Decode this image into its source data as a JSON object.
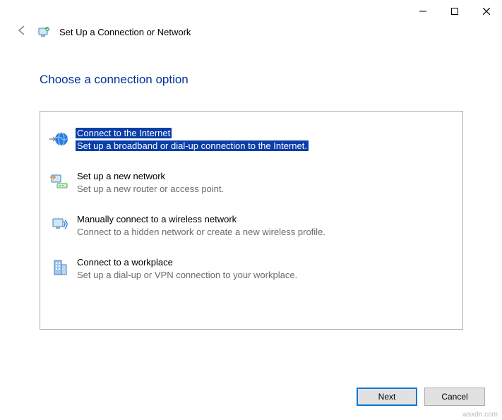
{
  "window": {
    "title": "Set Up a Connection or Network"
  },
  "instruction": "Choose a connection option",
  "options": [
    {
      "title": "Connect to the Internet",
      "desc": "Set up a broadband or dial-up connection to the Internet.",
      "selected": true
    },
    {
      "title": "Set up a new network",
      "desc": "Set up a new router or access point.",
      "selected": false
    },
    {
      "title": "Manually connect to a wireless network",
      "desc": "Connect to a hidden network or create a new wireless profile.",
      "selected": false
    },
    {
      "title": "Connect to a workplace",
      "desc": "Set up a dial-up or VPN connection to your workplace.",
      "selected": false
    }
  ],
  "buttons": {
    "next": "Next",
    "cancel": "Cancel"
  },
  "watermark": "wsxdn.com"
}
